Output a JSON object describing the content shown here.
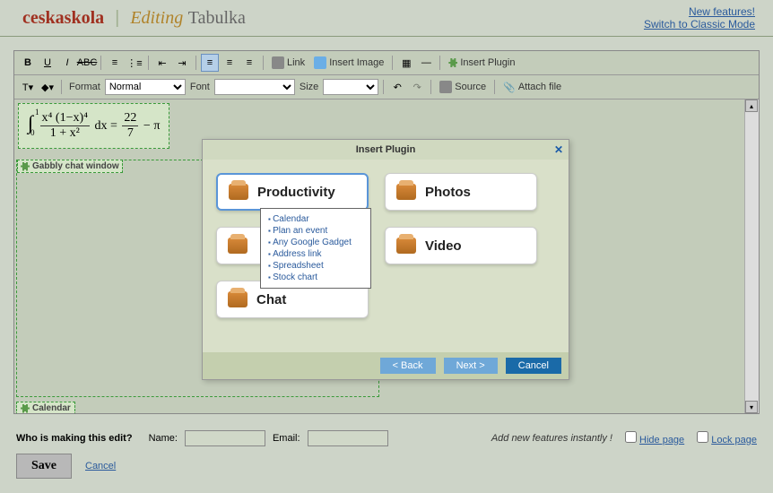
{
  "header": {
    "logo": "ceskaskola",
    "editing": "Editing",
    "page_name": "Tabulka",
    "links": {
      "new_features": "New features!",
      "classic": "Switch to Classic Mode"
    }
  },
  "toolbar": {
    "format_label": "Format",
    "format_value": "Normal",
    "font_label": "Font",
    "font_value": "",
    "size_label": "Size",
    "size_value": "",
    "link": "Link",
    "insert_image": "Insert Image",
    "insert_plugin": "Insert Plugin",
    "source": "Source",
    "attach": "Attach file"
  },
  "content": {
    "math_int": "∫",
    "math_0": "0",
    "math_1": "1",
    "math_num": "x⁴ (1−x)⁴",
    "math_den": "1 + x²",
    "math_dx": "dx =",
    "math_r1": "22",
    "math_r2": "7",
    "math_pi": "− π",
    "gabbly": "Gabbly chat window",
    "calendar": "Calendar"
  },
  "dialog": {
    "title": "Insert Plugin",
    "productivity": "Productivity",
    "photos": "Photos",
    "video": "Video",
    "chat": "Chat",
    "menu": [
      "Calendar",
      "Plan an event",
      "Any Google Gadget",
      "Address link",
      "Spreadsheet",
      "Stock chart"
    ],
    "back": "< Back",
    "next": "Next >",
    "cancel": "Cancel"
  },
  "footer": {
    "who": "Who is making this edit?",
    "name_label": "Name:",
    "email_label": "Email:",
    "instant": "Add new features instantly !",
    "hide": "Hide page",
    "lock": "Lock page",
    "save": "Save",
    "cancel": "Cancel"
  }
}
